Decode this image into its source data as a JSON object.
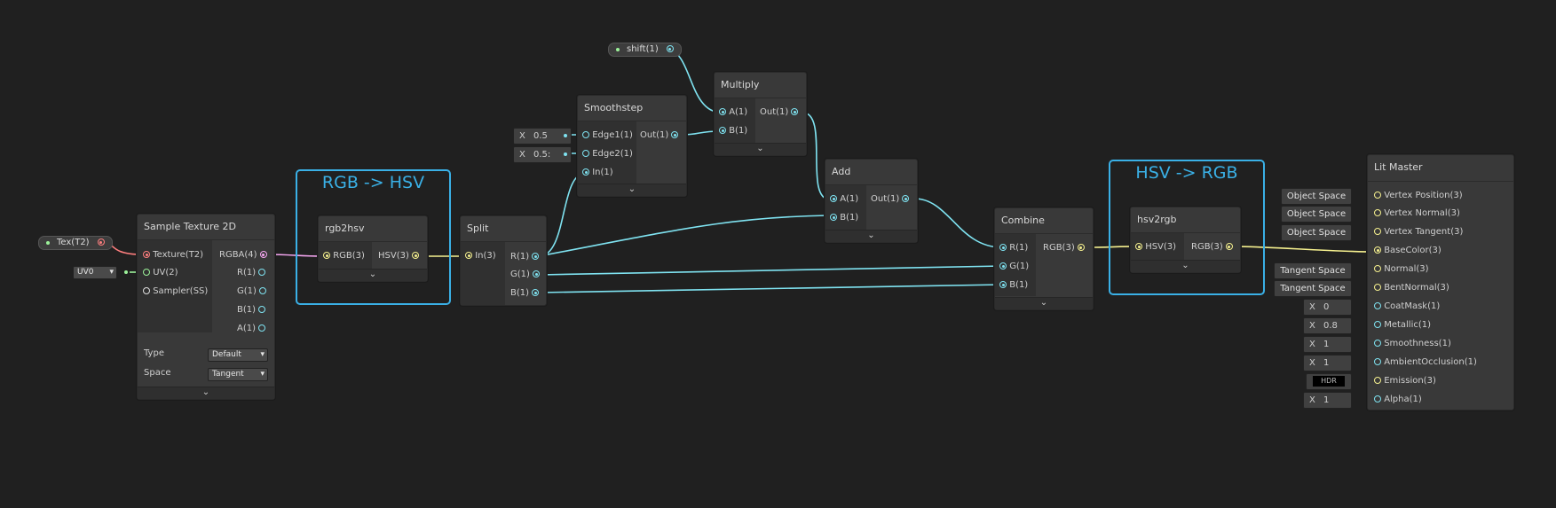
{
  "properties": {
    "tex": {
      "label": "Tex(T2)"
    },
    "shift": {
      "label": "shift(1)"
    }
  },
  "groups": {
    "rgb_hsv": "RGB -> HSV",
    "hsv_rgb": "HSV -> RGB"
  },
  "nodes": {
    "sample_texture": {
      "title": "Sample Texture 2D",
      "inputs": [
        "Texture(T2)",
        "UV(2)",
        "Sampler(SS)"
      ],
      "outputs": [
        "RGBA(4)",
        "R(1)",
        "G(1)",
        "B(1)",
        "A(1)"
      ],
      "uv_value": "UV0",
      "type_label": "Type",
      "type_value": "Default",
      "space_label": "Space",
      "space_value": "Tangent"
    },
    "rgb2hsv": {
      "title": "rgb2hsv",
      "input": "RGB(3)",
      "output": "HSV(3)"
    },
    "split": {
      "title": "Split",
      "input": "In(3)",
      "outputs": [
        "R(1)",
        "G(1)",
        "B(1)"
      ]
    },
    "smoothstep": {
      "title": "Smoothstep",
      "inputs": [
        "Edge1(1)",
        "Edge2(1)",
        "In(1)"
      ],
      "output": "Out(1)",
      "edge1_x": "X",
      "edge1_value": "0.5",
      "edge2_x": "X",
      "edge2_value": "0.5:"
    },
    "multiply": {
      "title": "Multiply",
      "inputs": [
        "A(1)",
        "B(1)"
      ],
      "output": "Out(1)"
    },
    "add": {
      "title": "Add",
      "inputs": [
        "A(1)",
        "B(1)"
      ],
      "output": "Out(1)"
    },
    "combine": {
      "title": "Combine",
      "inputs": [
        "R(1)",
        "G(1)",
        "B(1)"
      ],
      "output": "RGB(3)"
    },
    "hsv2rgb": {
      "title": "hsv2rgb",
      "input": "HSV(3)",
      "output": "RGB(3)"
    },
    "lit_master": {
      "title": "Lit Master",
      "inputs": [
        "Vertex Position(3)",
        "Vertex Normal(3)",
        "Vertex Tangent(3)",
        "BaseColor(3)",
        "Normal(3)",
        "BentNormal(3)",
        "CoatMask(1)",
        "Metallic(1)",
        "Smoothness(1)",
        "AmbientOcclusion(1)",
        "Emission(3)",
        "Alpha(1)"
      ],
      "fields": [
        "Object Space",
        "Object Space",
        "Object Space",
        "",
        "Tangent Space",
        "Tangent Space",
        "X 0",
        "X 0.8",
        "X 1",
        "X 1",
        "HDR",
        "X 1"
      ],
      "x_label": "X",
      "values": [
        "0",
        "0.8",
        "1",
        "1",
        "1"
      ],
      "hdr_label": "HDR"
    }
  },
  "colors": {
    "wire": "#7fe3f1",
    "wire_vec3": "#f6f18f",
    "wire_tex": "#ff7f7f",
    "wire_vec4": "#f7a7f2",
    "group": "#3ab0e6",
    "background": "#202020"
  },
  "icons": {
    "collapse": "chevron-down-icon"
  }
}
